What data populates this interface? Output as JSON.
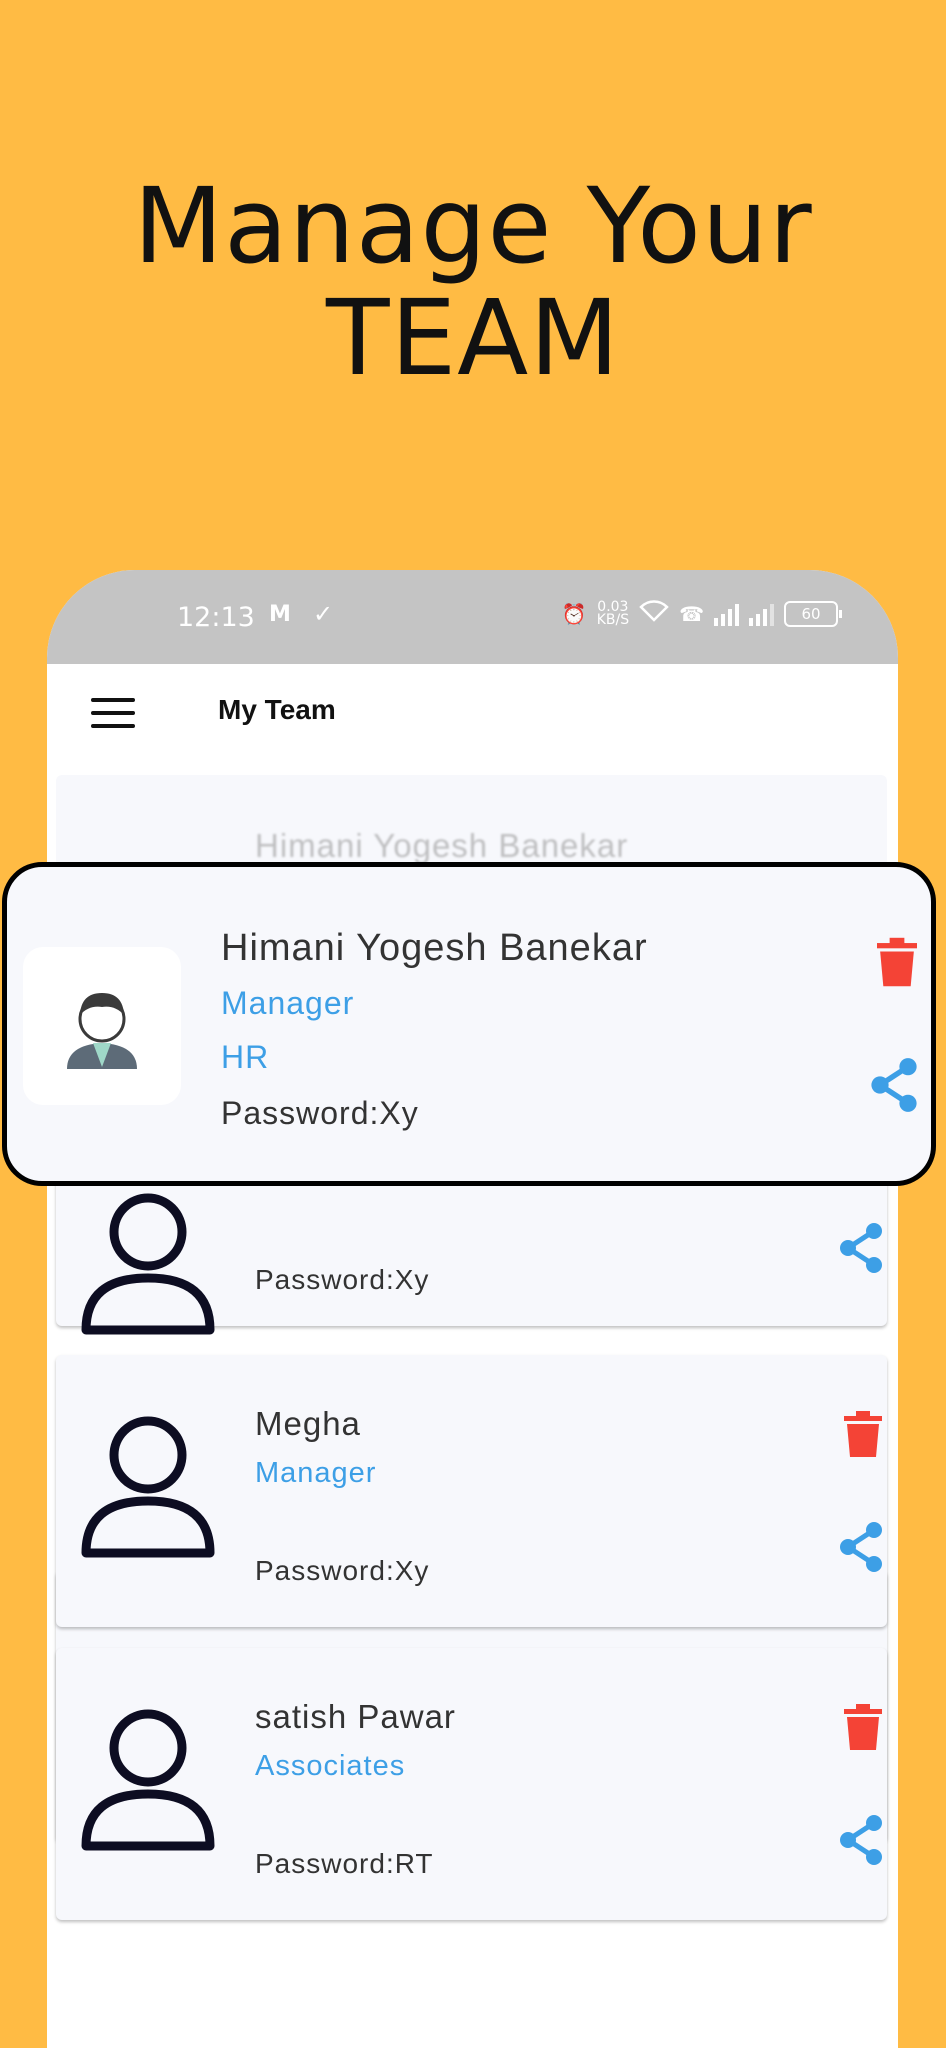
{
  "headline": {
    "line1": "Manage Your",
    "line2": "TEAM"
  },
  "status_bar": {
    "time": "12:13",
    "carrier_icon": "M",
    "network_speed": "0.03",
    "network_unit": "KB/S",
    "battery": "60"
  },
  "app_bar": {
    "title": "My Team"
  },
  "featured_member": {
    "name": "Himani Yogesh Banekar",
    "role": "Manager",
    "department": "HR",
    "password": "Password:Xy"
  },
  "team": [
    {
      "name": "Himani Yogesh Banekar",
      "role": "",
      "department": "HR",
      "password": "Password:Xy"
    },
    {
      "name": "Megha",
      "role": "Manager",
      "password": "Password:Xy"
    },
    {
      "name": "satish Pawar",
      "role": "Associates",
      "password": "Password:RT"
    }
  ],
  "colors": {
    "background": "#FFBB44",
    "accent": "#3D9FE6",
    "delete": "#F44336",
    "card": "#F7F8FC"
  }
}
